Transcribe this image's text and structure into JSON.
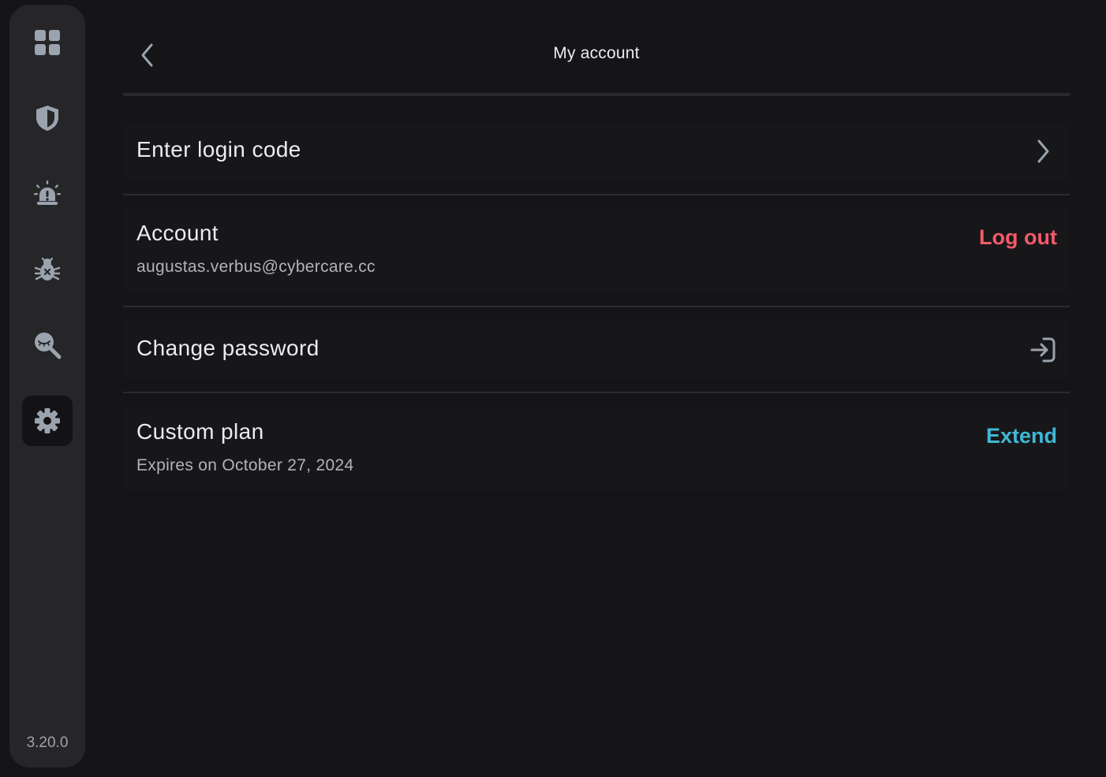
{
  "app": {
    "version": "3.20.0",
    "colors": {
      "background": "#151518",
      "sidebar": "#262628",
      "icon": "#9aa3ae",
      "danger": "#f25a6a",
      "accent": "#3fb8d6"
    }
  },
  "sidebar": {
    "items": [
      {
        "id": "dashboard",
        "icon": "grid-icon",
        "active": false
      },
      {
        "id": "protection",
        "icon": "shield-icon",
        "active": false
      },
      {
        "id": "alerts",
        "icon": "siren-icon",
        "active": false
      },
      {
        "id": "threats",
        "icon": "bug-icon",
        "active": false
      },
      {
        "id": "privacy",
        "icon": "search-eye-icon",
        "active": false
      },
      {
        "id": "settings",
        "icon": "gear-icon",
        "active": true
      }
    ]
  },
  "header": {
    "title": "My account",
    "back_icon": "chevron-left-icon"
  },
  "sections": {
    "login_code": {
      "title": "Enter login code",
      "icon": "chevron-right-icon"
    },
    "account": {
      "title": "Account",
      "email": "augustas.verbus@cybercare.cc",
      "action": "Log out"
    },
    "password": {
      "title": "Change password",
      "icon": "enter-arrow-icon"
    },
    "plan": {
      "title": "Custom plan",
      "expires": "Expires on October 27, 2024",
      "action": "Extend"
    }
  }
}
